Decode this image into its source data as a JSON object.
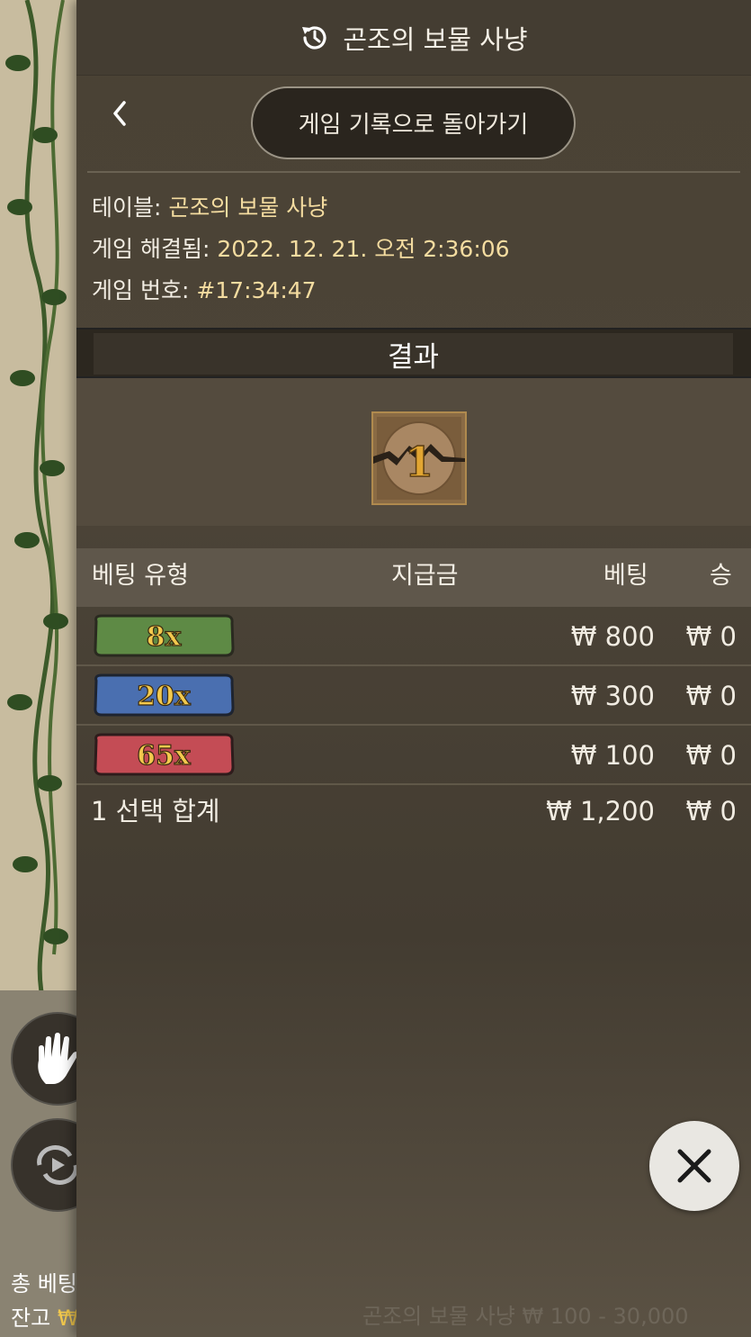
{
  "background": {
    "bottom": {
      "total_bet_label": "총 베팅금",
      "balance_label": "잔고",
      "currency": "₩"
    }
  },
  "panel": {
    "header": {
      "title": "곤조의 보물 사냥",
      "icon": "history-icon"
    },
    "nav": {
      "back_icon": "chevron-left-icon",
      "return_button": "게임 기록으로 돌아가기"
    },
    "info": {
      "table_label": "테이블:",
      "table_value": "곤조의 보물 사냥",
      "resolved_label": "게임 해결됨:",
      "resolved_value": "2022. 12. 21. 오전 2:36:06",
      "number_label": "게임 번호:",
      "number_value": "#17:34:47"
    },
    "result": {
      "heading": "결과",
      "tile_value": "1"
    },
    "table": {
      "headers": {
        "bet_type": "베팅 유형",
        "payout": "지급금",
        "bet": "베팅",
        "win": "승"
      },
      "rows": [
        {
          "multiplier": "8x",
          "color": "#5e8a45",
          "bet": "₩ 800",
          "win": "₩ 0"
        },
        {
          "multiplier": "20x",
          "color": "#4a6fb0",
          "bet": "₩ 300",
          "win": "₩ 0"
        },
        {
          "multiplier": "65x",
          "color": "#c44c55",
          "bet": "₩ 100",
          "win": "₩ 0"
        }
      ],
      "total": {
        "label": "1 선택 합계",
        "bet": "₩ 1,200",
        "win": "₩ 0"
      }
    },
    "close_icon": "close-icon",
    "ghost_footer": "곤조의 보물 사냥  ₩ 100 - 30,000"
  }
}
